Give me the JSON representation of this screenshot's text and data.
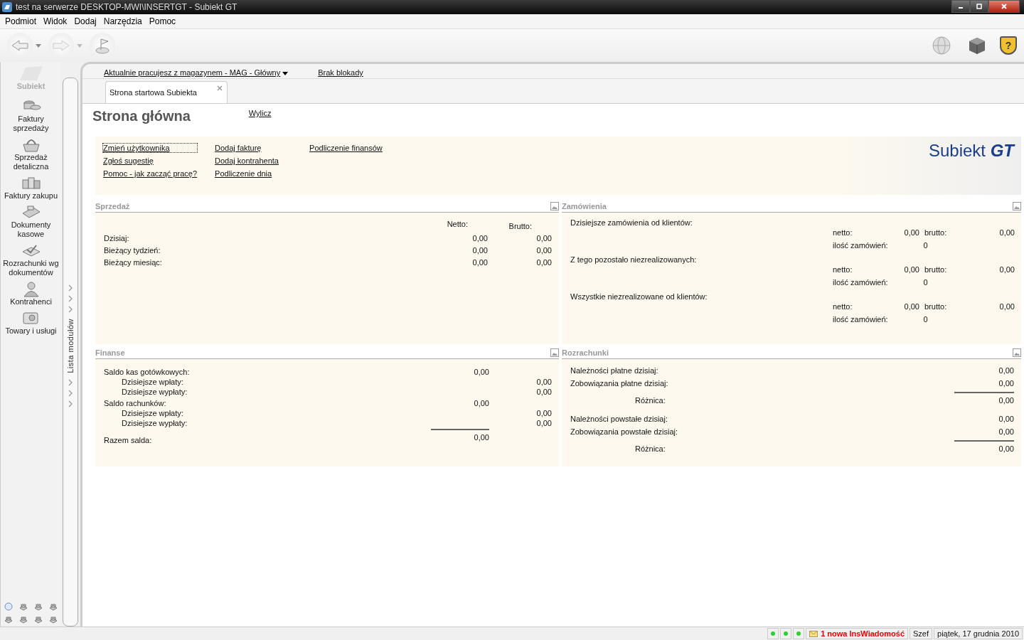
{
  "window": {
    "title": "test na serwerze DESKTOP-MWI\\INSERTGT - Subiekt GT"
  },
  "menu": [
    "Podmiot",
    "Widok",
    "Dodaj",
    "Narzędzia",
    "Pomoc"
  ],
  "toolbar": {
    "help_glyph": "?"
  },
  "sidebar": {
    "logo_label": "Subiekt",
    "panel_label": "Lista modułów",
    "items": [
      {
        "label": "Faktury sprzedaży"
      },
      {
        "label": "Sprzedaż detaliczna"
      },
      {
        "label": "Faktury zakupu"
      },
      {
        "label": "Dokumenty kasowe"
      },
      {
        "label": "Rozrachunki wg dokumentów"
      },
      {
        "label": "Kontrahenci"
      },
      {
        "label": "Towary i usługi"
      }
    ]
  },
  "info_bar": {
    "warehouse_link": "Aktualnie pracujesz z magazynem - MAG - Główny",
    "lock_link": "Brak blokady"
  },
  "tabs": [
    {
      "label": "Strona startowa Subiekta",
      "selected": true
    }
  ],
  "page": {
    "title": "Strona główna",
    "recalc_link": "Wylicz",
    "quick_links": [
      [
        "Zmień użytkownika",
        "Zgłoś sugestię",
        "Pomoc - jak zacząć pracę?"
      ],
      [
        "Dodaj fakturę",
        "Dodaj kontrahenta",
        "Podliczenie dnia"
      ],
      [
        "Podliczenie finansów"
      ]
    ],
    "logo_text": "Subiekt",
    "logo_suffix": "GT"
  },
  "sales": {
    "title": "Sprzedaż",
    "headers": [
      "Netto:",
      "Brutto:"
    ],
    "rows": [
      {
        "label": "Dzisiaj:",
        "netto": "0,00",
        "brutto": "0,00"
      },
      {
        "label": "Bieżący tydzień:",
        "netto": "0,00",
        "brutto": "0,00"
      },
      {
        "label": "Bieżący miesiąc:",
        "netto": "0,00",
        "brutto": "0,00"
      }
    ]
  },
  "orders": {
    "title": "Zamówienia",
    "groups": [
      {
        "label": "Dzisiejsze zamówienia od klientów:",
        "netto_label": "netto:",
        "netto": "0,00",
        "brutto_label": "brutto:",
        "brutto": "0,00",
        "count_label": "ilość zamówień:",
        "count": "0"
      },
      {
        "label": "Z tego pozostało niezrealizowanych:",
        "netto_label": "netto:",
        "netto": "0,00",
        "brutto_label": "brutto:",
        "brutto": "0,00",
        "count_label": "ilość zamówień:",
        "count": "0"
      },
      {
        "label": "Wszystkie niezrealizowane od klientów:",
        "netto_label": "netto:",
        "netto": "0,00",
        "brutto_label": "brutto:",
        "brutto": "0,00",
        "count_label": "ilość zamówień:",
        "count": "0"
      }
    ]
  },
  "finance": {
    "title": "Finanse",
    "rows": [
      {
        "kind": "main",
        "label": "Saldo kas gotówkowych:",
        "value": "0,00"
      },
      {
        "kind": "sub",
        "label": "Dzisiejsze wpłaty:",
        "value": "0,00"
      },
      {
        "kind": "sub",
        "label": "Dzisiejsze wypłaty:",
        "value": "0,00"
      },
      {
        "kind": "main",
        "label": "Saldo rachunków:",
        "value": "0,00"
      },
      {
        "kind": "sub",
        "label": "Dzisiejsze wpłaty:",
        "value": "0,00"
      },
      {
        "kind": "sub",
        "label": "Dzisiejsze wypłaty:",
        "value": "0,00"
      },
      {
        "kind": "total",
        "label": "Razem salda:",
        "value": "0,00"
      }
    ]
  },
  "settlements": {
    "title": "Rozrachunki",
    "rows": [
      {
        "kind": "item",
        "label": "Należności płatne dzisiaj:",
        "value": "0,00"
      },
      {
        "kind": "item",
        "label": "Zobowiązania płatne dzisiaj:",
        "value": "0,00"
      },
      {
        "kind": "difference",
        "label": "Różnica:",
        "value": "0,00"
      },
      {
        "kind": "item",
        "label": "Należności powstałe dzisiaj:",
        "value": "0,00"
      },
      {
        "kind": "item",
        "label": "Zobowiązania powstałe dzisiaj:",
        "value": "0,00"
      },
      {
        "kind": "difference",
        "label": "Różnica:",
        "value": "0,00"
      }
    ]
  },
  "status_bar": {
    "indicators": [
      {
        "color": "#33cc33"
      },
      {
        "color": "#33cc33"
      },
      {
        "color": "#33cc33"
      }
    ],
    "message": "1 nowa InsWiadomość",
    "user": "Szef",
    "date": "piątek, 17 grudnia 2010"
  }
}
